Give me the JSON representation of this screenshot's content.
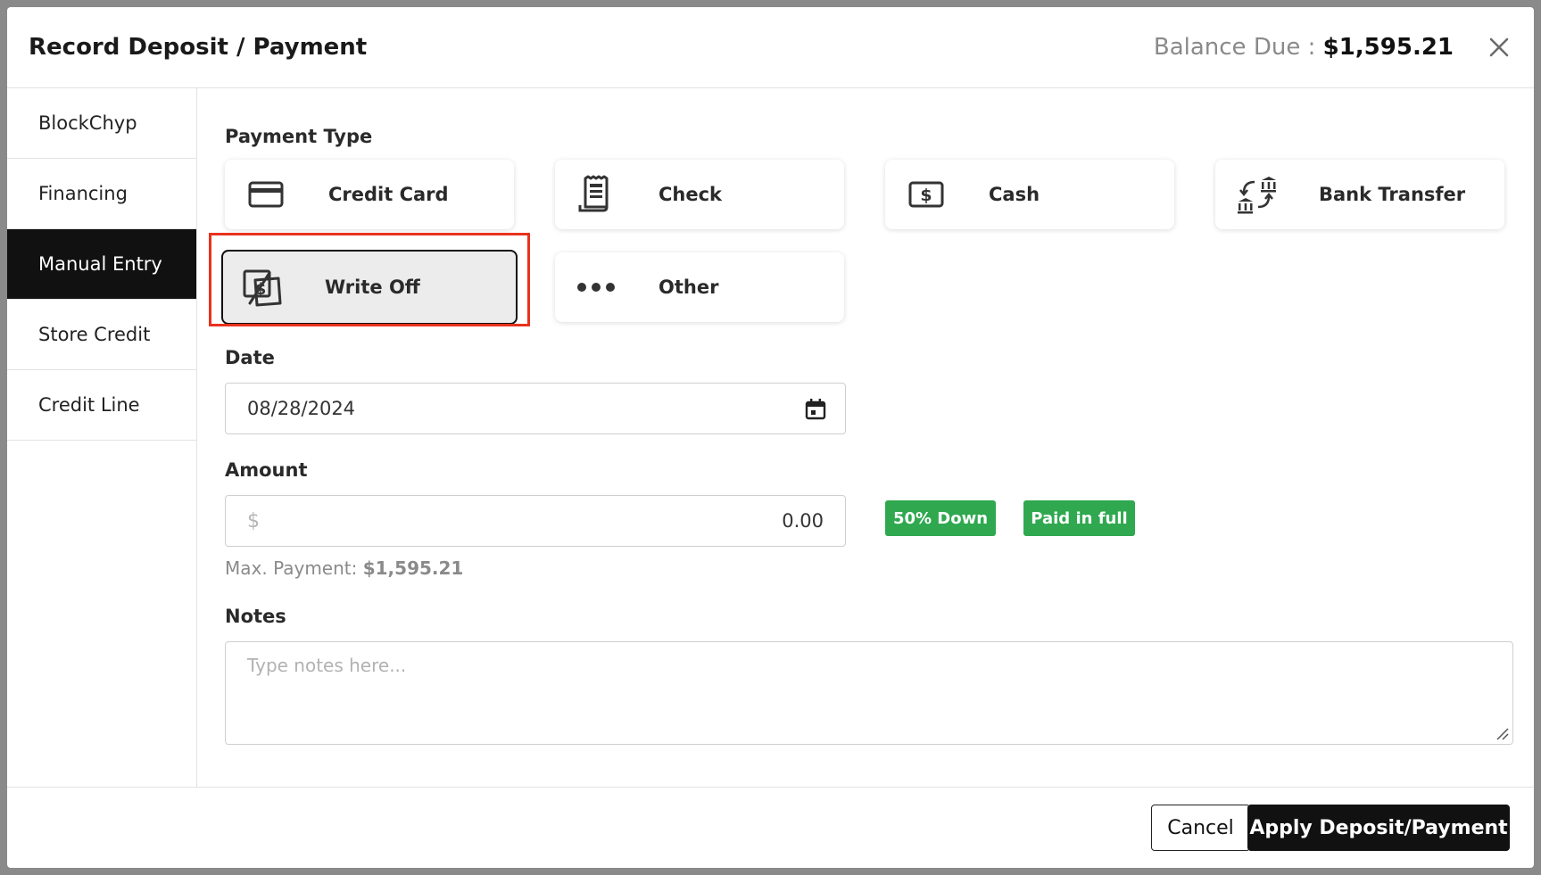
{
  "header": {
    "title": "Record Deposit / Payment",
    "balance_label": "Balance Due : ",
    "balance_value": "$1,595.21"
  },
  "sidebar": {
    "items": [
      {
        "label": "BlockChyp"
      },
      {
        "label": "Financing"
      },
      {
        "label": "Manual Entry"
      },
      {
        "label": "Store Credit"
      },
      {
        "label": "Credit Line"
      }
    ]
  },
  "payment_type": {
    "label": "Payment Type",
    "options": [
      {
        "label": "Credit Card",
        "icon": "credit-card-icon"
      },
      {
        "label": "Check",
        "icon": "check-receipt-icon"
      },
      {
        "label": "Cash",
        "icon": "cash-icon"
      },
      {
        "label": "Bank Transfer",
        "icon": "bank-transfer-icon"
      },
      {
        "label": "Write Off",
        "icon": "write-off-icon"
      },
      {
        "label": "Other",
        "icon": "more-dots-icon"
      }
    ],
    "selected": "Write Off"
  },
  "date": {
    "label": "Date",
    "value": "08/28/2024"
  },
  "amount": {
    "label": "Amount",
    "currency_symbol": "$",
    "value": "0.00",
    "max_label": "Max. Payment: ",
    "max_value": "$1,595.21",
    "quick": [
      "50% Down",
      "Paid in full"
    ]
  },
  "notes": {
    "label": "Notes",
    "placeholder": "Type notes here..."
  },
  "footer": {
    "cancel": "Cancel",
    "apply": "Apply Deposit/Payment"
  },
  "colors": {
    "accent_dark": "#111111",
    "badge_green": "#2fa84f",
    "highlight_red": "#e8321d"
  }
}
